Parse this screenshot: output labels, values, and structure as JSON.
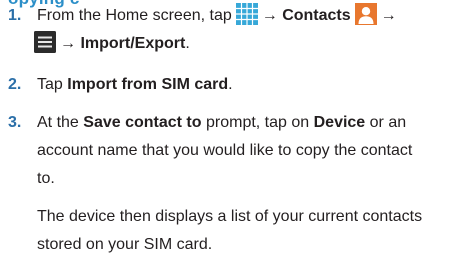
{
  "section_heading_fragment": "opying c",
  "steps": [
    {
      "number": "1.",
      "line1": {
        "prefix": "From the Home screen, tap",
        "arrow1": "→",
        "contacts_label": "Contacts",
        "arrow2": "→"
      },
      "line2": {
        "arrow": "→",
        "import_export_label": "Import/Export",
        "period": "."
      }
    },
    {
      "number": "2.",
      "prefix": "Tap",
      "bold": "Import from SIM card",
      "suffix": "."
    },
    {
      "number": "3.",
      "line1": {
        "prefix": "At the",
        "save_label": "Save contact to",
        "mid1": "prompt, tap on",
        "device_label": "Device",
        "mid2": "or an"
      },
      "line2": "account name that you would like to copy the contact",
      "line3": "to.",
      "line4": "The device then displays a list of your current contacts",
      "line5": "stored on your SIM card."
    }
  ],
  "icons": {
    "apps": "apps-grid-icon",
    "contacts": "contacts-icon",
    "menu": "menu-icon"
  },
  "colors": {
    "step_number": "#2b6fa8",
    "heading": "#2c8fc8",
    "apps_icon": "#37a8d8",
    "contacts_icon": "#e8772e",
    "menu_icon": "#2b2b2b"
  }
}
